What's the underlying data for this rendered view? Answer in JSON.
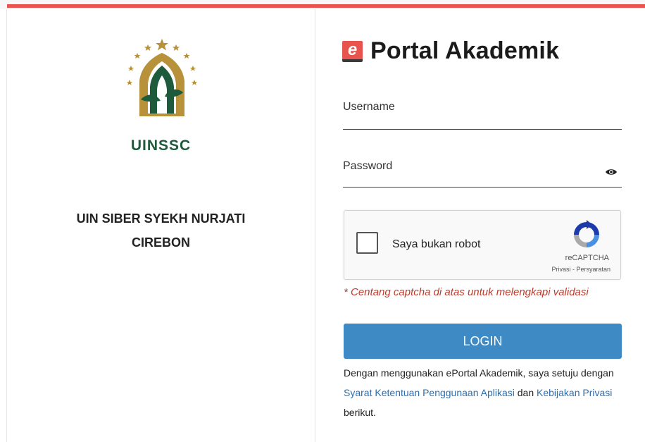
{
  "colors": {
    "accent_bar": "#e8534d",
    "logo_green": "#1e5a3c",
    "logo_gold": "#b8923a",
    "button": "#3d8ac4",
    "link": "#2a6db0",
    "warning": "#c0392b"
  },
  "left_panel": {
    "logo_text": "UINSSC",
    "university_name_line1": "UIN SIBER SYEKH NURJATI",
    "university_name_line2": "CIREBON"
  },
  "right_panel": {
    "brand_icon_letter": "e",
    "brand_title": "Portal Akademik",
    "username_label": "Username",
    "password_label": "Password",
    "password_toggle_icon": "eye-icon",
    "captcha": {
      "checkbox_label": "Saya bukan robot",
      "brand": "reCAPTCHA",
      "links": "Privasi - Persyaratan"
    },
    "captcha_warning": "* Centang captcha di atas untuk melengkapi validasi",
    "login_button": "LOGIN",
    "terms": {
      "prefix": "Dengan menggunakan ePortal Akademik, saya setuju dengan",
      "link1": "Syarat Ketentuan Penggunaan Aplikasi",
      "middle": "dan",
      "link2": "Kebijakan Privasi",
      "suffix": "berikut."
    }
  }
}
